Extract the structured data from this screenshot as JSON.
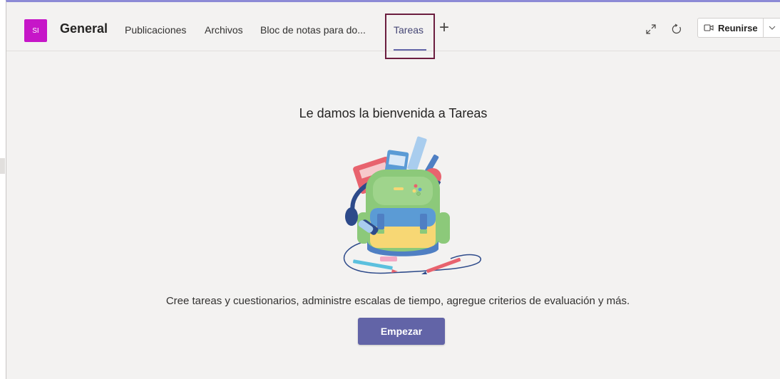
{
  "header": {
    "avatar_initials": "SI",
    "avatar_color": "#c616c8",
    "channel_name": "General",
    "tabs": [
      {
        "label": "Publicaciones"
      },
      {
        "label": "Archivos"
      },
      {
        "label": "Bloc de notas para do..."
      },
      {
        "label": "Tareas",
        "active": true
      }
    ],
    "add_tab_icon": "plus-icon",
    "expand_icon": "expand-icon",
    "refresh_icon": "refresh-icon",
    "meet_label": "Reunirse",
    "meet_icon": "video-camera-icon",
    "meet_dropdown_icon": "chevron-down-icon"
  },
  "main": {
    "welcome_title": "Le damos la bienvenida a Tareas",
    "illustration": "backpack-illustration",
    "description": "Cree tareas y cuestionarios, administre escalas de tiempo, agregue criterios de evaluación y más.",
    "start_button_label": "Empezar"
  },
  "colors": {
    "accent": "#6264a7",
    "highlight_border": "#6b1d3f",
    "background": "#f3f2f1"
  }
}
